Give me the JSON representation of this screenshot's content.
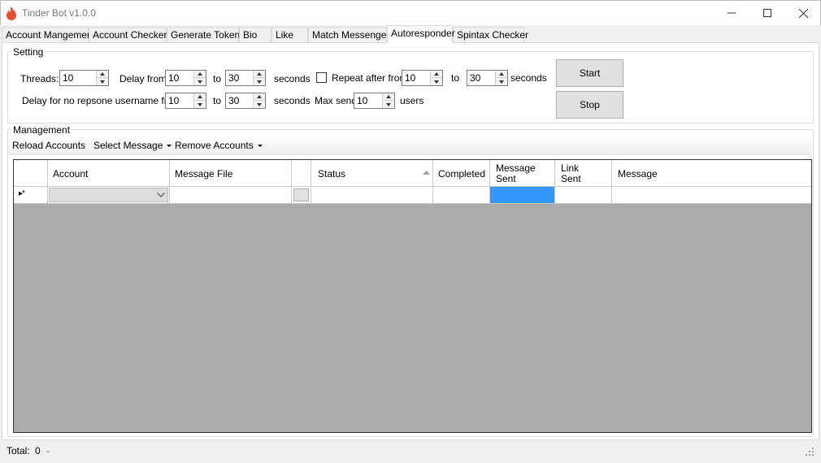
{
  "window": {
    "title": "Tinder Bot v1.0.0",
    "icon": "flame-icon",
    "controls": [
      "minimize-icon",
      "maximize-icon",
      "close-icon"
    ]
  },
  "tabs": [
    {
      "label": "Account Mangement",
      "active": false
    },
    {
      "label": "Account Checker",
      "active": false
    },
    {
      "label": "Generate Token",
      "active": false
    },
    {
      "label": "Bio",
      "active": false
    },
    {
      "label": "Like",
      "active": false
    },
    {
      "label": "Match Messenger",
      "active": false
    },
    {
      "label": "Autoresponder",
      "active": true
    },
    {
      "label": "Spintax Checker",
      "active": false
    }
  ],
  "setting": {
    "title": "Setting",
    "threads_label": "Threads:",
    "threads_value": "10",
    "delay_from_label": "Delay from",
    "delay_from_value": "10",
    "delay_to_label": "to",
    "delay_to_value": "30",
    "delay_unit": "seconds",
    "repeat_label": "Repeat after from",
    "repeat_checked": false,
    "repeat_from_value": "10",
    "repeat_to_label": "to",
    "repeat_to_value": "30",
    "repeat_unit": "seconds",
    "noresp_label": "Delay for no repsone username from",
    "noresp_from_value": "10",
    "noresp_to_label": "to",
    "noresp_to_value": "30",
    "noresp_unit": "seconds",
    "max_send_label": "Max send",
    "max_send_value": "10",
    "max_send_unit": "users"
  },
  "buttons": {
    "start": "Start",
    "stop": "Stop"
  },
  "management": {
    "title": "Management",
    "toolbar": {
      "reload": "Reload Accounts",
      "select_message": "Select Message",
      "remove_accounts": "Remove Accounts"
    },
    "columns": {
      "account": "Account",
      "message_file": "Message File",
      "status": "Status",
      "completed": "Completed",
      "message_sent_1": "Message",
      "message_sent_2": "Sent",
      "link_sent_1": "Link",
      "link_sent_2": "Sent",
      "message": "Message"
    },
    "new_row_marker": "▸*",
    "colors": {
      "selected_cell": "#3399ff",
      "grid_background": "#ababab"
    }
  },
  "status": {
    "total_label": "Total:",
    "total_value": "0",
    "extra": "-"
  }
}
